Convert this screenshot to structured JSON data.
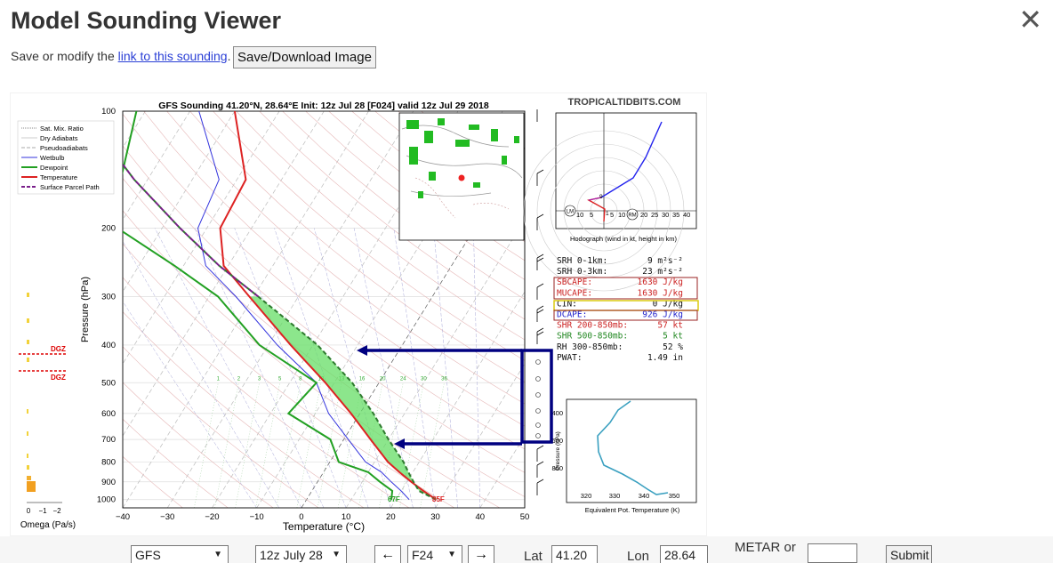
{
  "modal": {
    "title": "Model Sounding Viewer",
    "close_glyph": "✕",
    "sub_prefix": "Save or modify the ",
    "sub_link": "link to this sounding",
    "sub_suffix": ".",
    "save_button": "Save/Download Image"
  },
  "chart": {
    "title": "GFS Sounding 41.20°N, 28.64°E Init: 12z Jul 28 [F024] valid 12z Jul 29 2018",
    "site": "TROPICALTIDBITS.COM",
    "ylabel": "Pressure (hPa)",
    "xlabel": "Temperature (°C)",
    "omega_label": "Omega (Pa/s)",
    "omega_ticks": [
      "0",
      "−1",
      "−2"
    ],
    "dgz": "DGZ",
    "pressure_ticks": [
      "100",
      "200",
      "300",
      "400",
      "500",
      "600",
      "700",
      "800",
      "900",
      "1000"
    ],
    "temp_ticks": [
      "−40",
      "−30",
      "−20",
      "−10",
      "0",
      "10",
      "20",
      "30",
      "40",
      "50"
    ],
    "surface_dewpoint": "67F",
    "surface_temp": "85F",
    "legend": [
      "Sat. Mix. Ratio",
      "Dry Adiabats",
      "Pseudoadiabats",
      "Wetbulb",
      "Dewpoint",
      "Temperature",
      "Surface Parcel Path"
    ],
    "mix_ratio_labels": [
      "1",
      "2",
      "3",
      "5",
      "8",
      "10",
      "13",
      "16",
      "20",
      "24",
      "30",
      "36"
    ],
    "colors": {
      "temperature": "#dd2222",
      "dewpoint": "#22a022",
      "parcel": "#7a1f8a",
      "wetbulb": "#3333dd",
      "cape": "#66dd66",
      "annotation": "#000080"
    }
  },
  "hodograph": {
    "caption": "Hodograph (wind in kt, height in km)",
    "ring_labels": [
      "10",
      "5",
      "5",
      "10",
      "20",
      "25",
      "30",
      "35",
      "40"
    ],
    "lm": "LM",
    "rm": "RM",
    "height_labels": [
      "9",
      "1",
      "3"
    ]
  },
  "indices": [
    {
      "label": "SRH 0-1km:",
      "value": "9",
      "unit": "m²s⁻²",
      "color": "#111"
    },
    {
      "label": "SRH 0-3km:",
      "value": "23",
      "unit": "m²s⁻²",
      "color": "#111"
    },
    {
      "label": "SBCAPE:",
      "value": "1630 J/kg",
      "unit": "",
      "color": "#cc2222"
    },
    {
      "label": "MUCAPE:",
      "value": "1630 J/kg",
      "unit": "",
      "color": "#cc2222"
    },
    {
      "label": "CIN:",
      "value": "0 J/kg",
      "unit": "",
      "color": "#111"
    },
    {
      "label": "DCAPE:",
      "value": "926 J/kg",
      "unit": "",
      "color": "#2222cc"
    },
    {
      "label": "SHR 200-850mb:",
      "value": "57 kt",
      "unit": "",
      "color": "#cc2222"
    },
    {
      "label": "SHR 500-850mb:",
      "value": "5 kt",
      "unit": "",
      "color": "#228822"
    },
    {
      "label": "RH 300-850mb:",
      "value": "52 %",
      "unit": "",
      "color": "#111"
    },
    {
      "label": "PWAT:",
      "value": "1.49 in",
      "unit": "",
      "color": "#111"
    }
  ],
  "theta_plot": {
    "xlabel": "Equivalent Pot. Temperature (K)",
    "ylabel": "Pressure (hPa)",
    "xticks": [
      "320",
      "330",
      "340",
      "350"
    ],
    "yticks": [
      "400",
      "600",
      "800"
    ]
  },
  "controls": {
    "model": "GFS",
    "run": "12z July 28",
    "prev": "←",
    "forecast": "F24",
    "next": "→",
    "lat_label": "Lat",
    "lat_value": "41.20",
    "lon_label": "Lon",
    "lon_value": "28.64",
    "metar_label": "METAR or",
    "metar_value": "",
    "submit": "Submit"
  }
}
